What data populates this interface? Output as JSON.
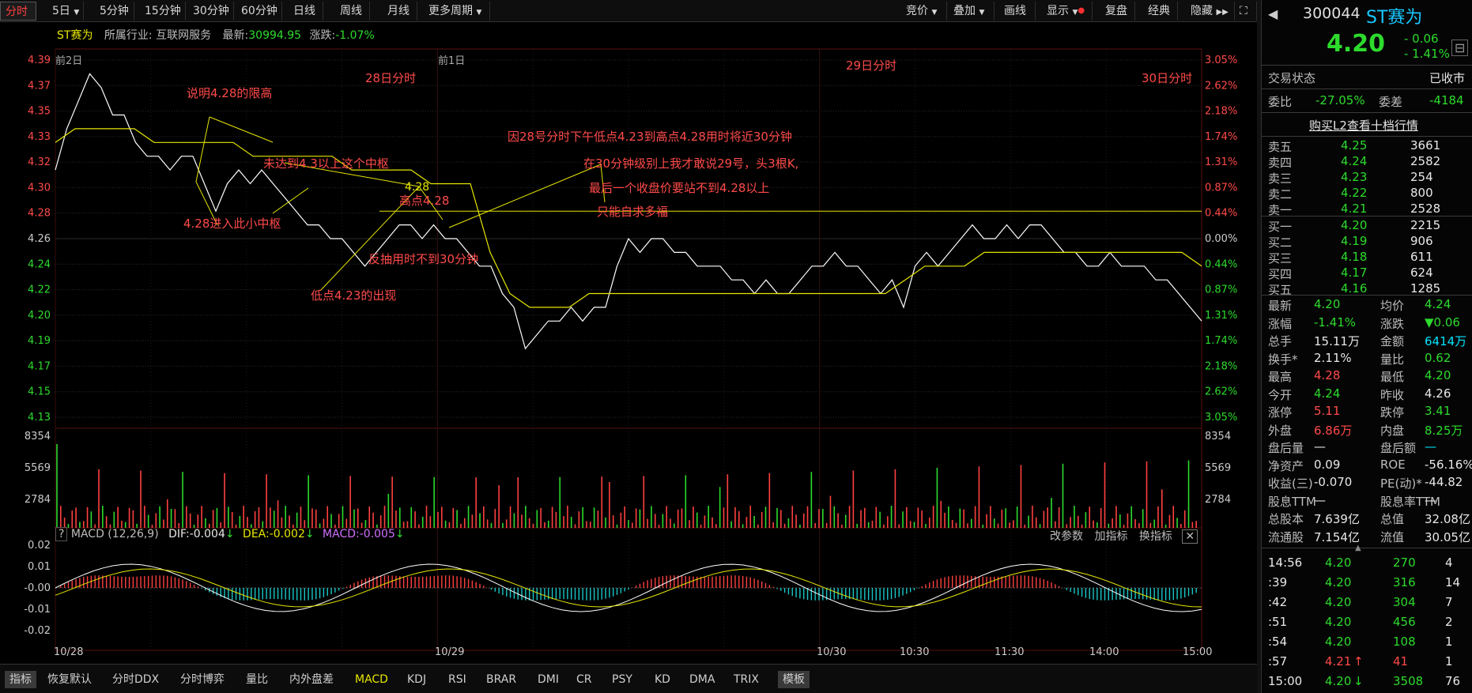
{
  "toolbar": {
    "left_tabs": [
      "分时",
      "5日",
      "5分钟",
      "15分钟",
      "30分钟",
      "60分钟",
      "日线",
      "周线",
      "月线",
      "更多周期"
    ],
    "right_tabs": [
      "竞价",
      "叠加",
      "画线",
      "显示",
      "复盘",
      "经典",
      "隐藏"
    ]
  },
  "info_line": {
    "name": "ST赛为",
    "industry_label": "所属行业:",
    "industry": "互联网服务",
    "latest_label": "最新:",
    "latest": "30994.95",
    "change_label": "涨跌:",
    "change": "-1.07%"
  },
  "chart_data": {
    "type": "line",
    "days": [
      "10/28",
      "10/29",
      "10/30"
    ],
    "day_headers": [
      "前2日",
      "前1日",
      ""
    ],
    "price_ticks_left": [
      "4.39",
      "4.37",
      "4.35",
      "4.33",
      "4.32",
      "4.30",
      "4.28",
      "4.26",
      "4.24",
      "4.22",
      "4.20",
      "4.19",
      "4.17",
      "4.15",
      "4.13"
    ],
    "pct_ticks_right": [
      "3.05%",
      "2.62%",
      "2.18%",
      "1.74%",
      "1.31%",
      "0.87%",
      "0.44%",
      "0.00%",
      "0.44%",
      "0.87%",
      "1.31%",
      "1.74%",
      "2.18%",
      "2.62%",
      "3.05%"
    ],
    "ylim": [
      4.13,
      4.39
    ],
    "prev_close": 4.26,
    "reference_line": 4.28,
    "volume_ticks": [
      "8354",
      "5569",
      "2784"
    ],
    "macd_header": {
      "name": "MACD (12,26,9)",
      "dif": "DIF:-0.004",
      "dea": "DEA:-0.002",
      "macd": "MACD:-0.005"
    },
    "macd_ticks": [
      "0.02",
      "0.01",
      "-0.00",
      "-0.01",
      "-0.02"
    ],
    "macd_buttons": [
      "改参数",
      "加指标",
      "换指标"
    ],
    "x_time_labels": [
      "10/28",
      "10/29",
      "10/30",
      "10:30",
      "11:30",
      "14:00",
      "15:00"
    ],
    "series": [
      {
        "name": "price",
        "values": [
          4.31,
          4.34,
          4.36,
          4.38,
          4.37,
          4.35,
          4.35,
          4.33,
          4.32,
          4.32,
          4.31,
          4.32,
          4.32,
          4.3,
          4.28,
          4.3,
          4.31,
          4.3,
          4.31,
          4.3,
          4.29,
          4.28,
          4.27,
          4.27,
          4.26,
          4.26,
          4.25,
          4.24,
          4.25,
          4.26,
          4.27,
          4.27,
          4.26,
          4.27,
          4.26,
          4.26,
          4.25,
          4.24,
          4.24,
          4.22,
          4.21,
          4.18,
          4.19,
          4.2,
          4.2,
          4.21,
          4.2,
          4.21,
          4.21,
          4.24,
          4.26,
          4.25,
          4.26,
          4.26,
          4.25,
          4.25,
          4.24,
          4.24,
          4.24,
          4.23,
          4.23,
          4.22,
          4.23,
          4.22,
          4.22,
          4.23,
          4.24,
          4.24,
          4.25,
          4.24,
          4.24,
          4.23,
          4.22,
          4.23,
          4.21,
          4.24,
          4.25,
          4.24,
          4.25,
          4.26,
          4.27,
          4.26,
          4.26,
          4.27,
          4.26,
          4.27,
          4.27,
          4.26,
          4.25,
          4.25,
          4.24,
          4.24,
          4.25,
          4.24,
          4.24,
          4.24,
          4.23,
          4.23,
          4.22,
          4.21,
          4.2
        ]
      },
      {
        "name": "avg",
        "values": [
          4.33,
          4.34,
          4.34,
          4.34,
          4.34,
          4.33,
          4.33,
          4.33,
          4.33,
          4.33,
          4.32,
          4.32,
          4.32,
          4.32,
          4.32,
          4.31,
          4.31,
          4.31,
          4.31,
          4.3,
          4.3,
          4.3,
          4.25,
          4.22,
          4.21,
          4.21,
          4.21,
          4.22,
          4.22,
          4.22,
          4.22,
          4.22,
          4.22,
          4.22,
          4.22,
          4.22,
          4.22,
          4.22,
          4.22,
          4.22,
          4.22,
          4.22,
          4.22,
          4.23,
          4.24,
          4.24,
          4.24,
          4.25,
          4.25,
          4.25,
          4.25,
          4.25,
          4.25,
          4.25,
          4.25,
          4.25,
          4.25,
          4.25,
          4.24
        ]
      }
    ]
  },
  "annotations": {
    "a1": "说明4.28的限高",
    "a2": "28日分时",
    "a3": "29日分时",
    "a4": "30日分时",
    "a5": "因28号分时下午低点4.23到高点4.28用时将近30分钟",
    "a6": "未达到4.3以上这个中枢",
    "a7": "在30分钟级别上我才敢说29号，头3根K,",
    "a8": "4.28",
    "a9": "高点4.28",
    "a10": "最后一个收盘价要站不到4.28以上",
    "a11": "只能自求多福",
    "a12": "4.28进入此小中枢",
    "a13": "反抽用时不到30分钟",
    "a14": "低点4.23的出现"
  },
  "bottom_bar": {
    "items": [
      "指标",
      "恢复默认",
      "分时DDX",
      "分时博弈",
      "量比",
      "内外盘差",
      "MACD",
      "KDJ",
      "RSI",
      "BRAR",
      "DMI",
      "CR",
      "PSY",
      "KD",
      "DMA",
      "TRIX",
      "模板"
    ]
  },
  "right_panel": {
    "code": "300044",
    "name": "ST赛为",
    "price": "4.20",
    "chg": "- 0.06",
    "chg_pct": "- 1.41%",
    "status_label": "交易状态",
    "status": "已收市",
    "weibi_label": "委比",
    "weibi": "-27.05%",
    "weicha_label": "委差",
    "weicha": "-4184",
    "l2_link": "购买L2查看十档行情",
    "asks": [
      {
        "label": "卖五",
        "price": "4.25",
        "vol": "3661"
      },
      {
        "label": "卖四",
        "price": "4.24",
        "vol": "2582"
      },
      {
        "label": "卖三",
        "price": "4.23",
        "vol": "254"
      },
      {
        "label": "卖二",
        "price": "4.22",
        "vol": "800"
      },
      {
        "label": "卖一",
        "price": "4.21",
        "vol": "2528"
      }
    ],
    "bids": [
      {
        "label": "买一",
        "price": "4.20",
        "vol": "2215"
      },
      {
        "label": "买二",
        "price": "4.19",
        "vol": "906"
      },
      {
        "label": "买三",
        "price": "4.18",
        "vol": "611"
      },
      {
        "label": "买四",
        "price": "4.17",
        "vol": "624"
      },
      {
        "label": "买五",
        "price": "4.16",
        "vol": "1285"
      }
    ],
    "stats": [
      {
        "l1": "最新",
        "v1": "4.20",
        "c1": "green",
        "l2": "均价",
        "v2": "4.24",
        "c2": "green"
      },
      {
        "l1": "涨幅",
        "v1": "-1.41%",
        "c1": "green",
        "l2": "涨跌",
        "v2": "▼0.06",
        "c2": "green"
      },
      {
        "l1": "总手",
        "v1": "15.11万",
        "c1": "white",
        "l2": "金额",
        "v2": "6414万",
        "c2": "cyan"
      },
      {
        "l1": "换手*",
        "v1": "2.11%",
        "c1": "white",
        "l2": "量比",
        "v2": "0.62",
        "c2": "green"
      },
      {
        "l1": "最高",
        "v1": "4.28",
        "c1": "red",
        "l2": "最低",
        "v2": "4.20",
        "c2": "green"
      },
      {
        "l1": "今开",
        "v1": "4.24",
        "c1": "green",
        "l2": "昨收",
        "v2": "4.26",
        "c2": "white"
      },
      {
        "l1": "涨停",
        "v1": "5.11",
        "c1": "red",
        "l2": "跌停",
        "v2": "3.41",
        "c2": "green"
      },
      {
        "l1": "外盘",
        "v1": "6.86万",
        "c1": "red",
        "l2": "内盘",
        "v2": "8.25万",
        "c2": "green"
      },
      {
        "l1": "盘后量",
        "v1": "—",
        "c1": "white",
        "l2": "盘后额",
        "v2": "—",
        "c2": "cyan"
      },
      {
        "l1": "净资产",
        "v1": "0.09",
        "c1": "white",
        "l2": "ROE",
        "v2": "-56.16%",
        "c2": "white"
      },
      {
        "l1": "收益(三)",
        "v1": "-0.070",
        "c1": "white",
        "l2": "PE(动)*",
        "v2": "-44.82",
        "c2": "white"
      },
      {
        "l1": "股息TTM",
        "v1": "—",
        "c1": "white",
        "l2": "股息率TTM",
        "v2": "—",
        "c2": "white"
      },
      {
        "l1": "总股本",
        "v1": "7.639亿",
        "c1": "white",
        "l2": "总值",
        "v2": "32.08亿",
        "c2": "white"
      },
      {
        "l1": "流通股",
        "v1": "7.154亿",
        "c1": "white",
        "l2": "流值",
        "v2": "30.05亿",
        "c2": "white"
      }
    ],
    "ticks": [
      {
        "time": "14:56",
        "price": "4.20",
        "vol": "270",
        "n": "4",
        "arrow": ""
      },
      {
        "time": ":39",
        "price": "4.20",
        "vol": "316",
        "n": "14",
        "arrow": ""
      },
      {
        "time": ":42",
        "price": "4.20",
        "vol": "304",
        "n": "7",
        "arrow": ""
      },
      {
        "time": ":51",
        "price": "4.20",
        "vol": "456",
        "n": "2",
        "arrow": ""
      },
      {
        "time": ":54",
        "price": "4.20",
        "vol": "108",
        "n": "1",
        "arrow": ""
      },
      {
        "time": ":57",
        "price": "4.21",
        "vol": "41",
        "n": "1",
        "arrow": "↑"
      },
      {
        "time": "15:00",
        "price": "4.20",
        "vol": "3508",
        "n": "76",
        "arrow": "↓"
      }
    ]
  }
}
